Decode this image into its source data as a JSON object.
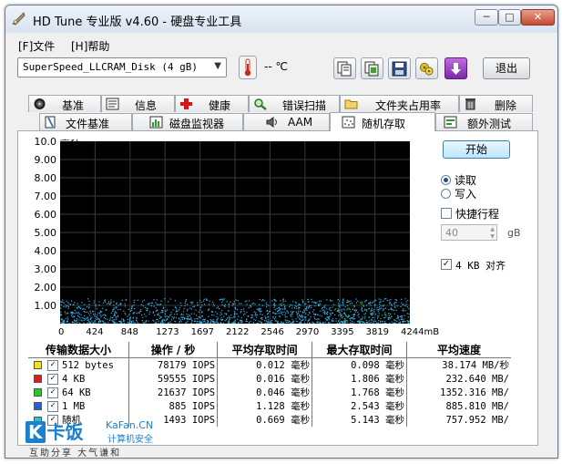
{
  "window": {
    "title": "HD Tune 专业版 v4.60 - 硬盘专业工具",
    "minimize_glyph": "─",
    "maximize_glyph": "□",
    "close_glyph": "✕"
  },
  "menu": [
    "[F]文件",
    "[H]帮助"
  ],
  "toolbar": {
    "drive": "SuperSpeed_LLCRAM_Disk (4 gB)",
    "temperature": "-- ℃",
    "exit_label": "退出",
    "icons": [
      "thermometer-icon",
      "copy-text-icon",
      "copy-screen-icon",
      "save-icon",
      "options-icon",
      "download-icon"
    ]
  },
  "tabs": {
    "row1": [
      "基准",
      "信息",
      "健康",
      "错误扫描",
      "文件夹占用率",
      "删除"
    ],
    "row2": [
      "文件基准",
      "磁盘监视器",
      "AAM",
      "随机存取",
      "额外测试"
    ],
    "active": "随机存取"
  },
  "chart_data": {
    "type": "scatter",
    "title": "",
    "ylabel": "毫秒",
    "xlabel": "",
    "y_ticks": [
      "10.0",
      "9.00",
      "8.00",
      "7.00",
      "6.00",
      "5.00",
      "4.00",
      "3.00",
      "2.00",
      "1.00"
    ],
    "x_ticks": [
      "0",
      "424",
      "848",
      "1273",
      "1697",
      "2122",
      "2546",
      "2970",
      "3395",
      "3819",
      "4244mB"
    ],
    "xlim": [
      0,
      4244
    ],
    "ylim": [
      0,
      10
    ],
    "grid": true,
    "background": "#000000",
    "series_color": "#37b6ef",
    "band": {
      "x_from": 0,
      "x_to": 4244,
      "y_from": 0.05,
      "y_to": 1.4
    }
  },
  "controls": {
    "start_label": "开始",
    "read_label": "读取",
    "write_label": "写入",
    "read_selected": true,
    "quick_label": "快捷行程",
    "quick_checked": false,
    "quick_value": "40",
    "quick_unit": "gB",
    "align_label": "4 KB 对齐",
    "align_checked": true
  },
  "results": {
    "headers": [
      "传输数据大小",
      "操作 / 秒",
      "平均存取时间",
      "最大存取时间",
      "平均速度"
    ],
    "rows": [
      {
        "size": "512 bytes",
        "color": "#f5e11a",
        "ops": "78179 IOPS",
        "avg": "0.012 毫秒",
        "max": "0.098 毫秒",
        "speed": "38.174 MB/秒"
      },
      {
        "size": "4 KB",
        "color": "#d81f1f",
        "ops": "59555 IOPS",
        "avg": "0.016 毫秒",
        "max": "1.806 毫秒",
        "speed": "232.640 MB/"
      },
      {
        "size": "64 KB",
        "color": "#2bc42b",
        "ops": "21637 IOPS",
        "avg": "0.046 毫秒",
        "max": "1.768 毫秒",
        "speed": "1352.316 MB/"
      },
      {
        "size": "1 MB",
        "color": "#2b5fd0",
        "ops": "885 IOPS",
        "avg": "1.128 毫秒",
        "max": "2.543 毫秒",
        "speed": "885.810 MB/"
      },
      {
        "size": "随机",
        "color": "#2bc0d0",
        "ops": "1493 IOPS",
        "avg": "0.669 毫秒",
        "max": "5.143 毫秒",
        "speed": "757.952 MB/"
      }
    ]
  },
  "watermark": {
    "k": "K",
    "logo": "卡饭",
    "site": "KaFan.CN",
    "sub": "计算机安全",
    "slogan": "互助分享  大气谦和"
  }
}
